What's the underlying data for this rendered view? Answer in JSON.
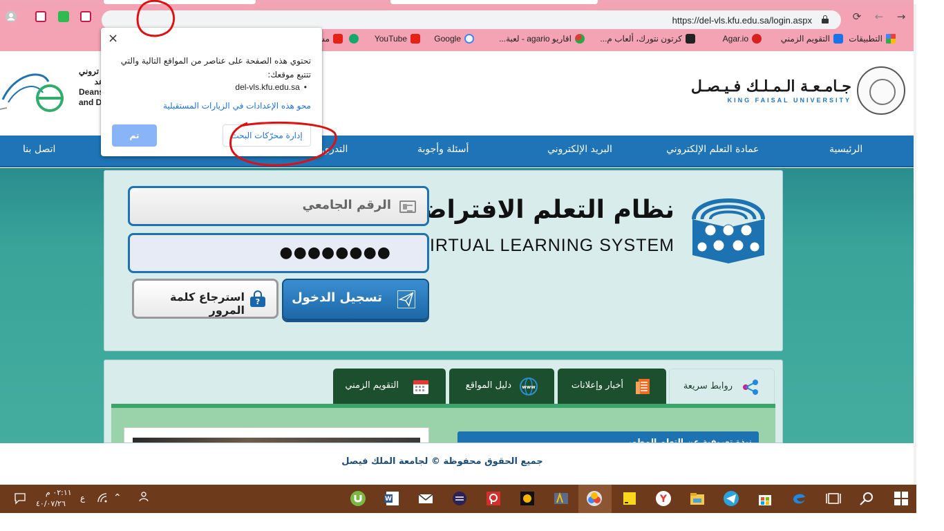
{
  "browser": {
    "url": "https://del-vls.kfu.edu.sa/login.aspx",
    "bookmarks": [
      {
        "label": "التطبيقات",
        "color": "#e8453c"
      },
      {
        "label": "التقويم الزمني",
        "color": "#1a73e8"
      },
      {
        "label": "Agar.io",
        "color": "#d62020"
      },
      {
        "label": "كرتون نتورك، ألعاب م...",
        "color": "#222222"
      },
      {
        "label": "اقاريو agario - لعبة...",
        "color": "#28a745"
      },
      {
        "label": "Google",
        "color": "#4285f4"
      },
      {
        "label": "YouTube",
        "color": "#e62117"
      },
      {
        "label": "",
        "color": "#15a86b"
      },
      {
        "label": "مسلسل",
        "color": "#e62117"
      }
    ]
  },
  "popup": {
    "close": "×",
    "message": "تحتوي هذه الصفحة على عناصر من المواقع التالية والتي تتتبع موقعك:",
    "site": "del-vls.kfu.edu.sa",
    "clear_link": "محو هذه الإعدادات في الزيارات المستقبلية",
    "manage_button": "إدارة محرّكات البحث",
    "done_button": "تم"
  },
  "header": {
    "university_ar": "جـامـعـة الـمـلـك فـيـصـل",
    "university_en": "KING FAISAL UNIVERSITY",
    "dean_line1": "تروني",
    "dean_line2": "Deans",
    "dean_line3": "and D",
    "dean_ar2": "عد"
  },
  "nav": {
    "items": [
      "الرئيسية",
      "عمادة التعلم الإلكتروني",
      "البريد الإلكتروني",
      "أسئلة وأجوبة",
      "التدري",
      "اتصل بنا"
    ]
  },
  "login": {
    "title_ar": "نظام التعلم الافتراضي",
    "title_en": "VIRTUAL LEARNING SYSTEM",
    "uid_placeholder": "الرقم الجامعي",
    "password_mask": "●●●●●●●●",
    "login_button": "تسجيل الدخول",
    "recover_button": "استرجاع كلمة المرور",
    "recover_icon": "?"
  },
  "tabs": {
    "items": [
      {
        "label": "روابط سريعة",
        "icon": "share-icon",
        "active": true
      },
      {
        "label": "أخبار وإعلانات",
        "icon": "news-icon",
        "active": false
      },
      {
        "label": "دليل المواقع",
        "icon": "www-icon",
        "active": false
      },
      {
        "label": "التقويم الزمني",
        "icon": "calendar-icon",
        "active": false
      }
    ],
    "news_title": "نبذة تعريفية عن التعلم المطور"
  },
  "footer": {
    "text": "جميع الحقوق محفوظة © لجامعة الملك فيصل"
  },
  "taskbar": {
    "time": "٠٢:١١ م",
    "date": "٤٠/٠٧/٢٦",
    "lang": "ع"
  },
  "colors": {
    "navbar": "#1e74b6",
    "accent_pink": "#f4a3b4",
    "teal": "#3aa49a",
    "tab_dark_green": "#1c4f2d",
    "taskbar": "#6e3a1c"
  }
}
